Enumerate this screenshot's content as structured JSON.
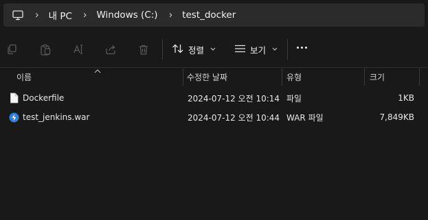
{
  "address_bar": {
    "breadcrumbs": [
      "내 PC",
      "Windows (C:)",
      "test_docker"
    ],
    "separator": "›"
  },
  "toolbar": {
    "sort_label": "정렬",
    "view_label": "보기"
  },
  "columns": {
    "name": "이름",
    "modified": "수정한 날짜",
    "type": "유형",
    "size": "크기"
  },
  "files": [
    {
      "name": "Dockerfile",
      "modified": "2024-07-12 오전 10:14",
      "type": "파일",
      "size": "1KB",
      "icon": "file-icon"
    },
    {
      "name": "test_jenkins.war",
      "modified": "2024-07-12 오전 10:44",
      "type": "WAR 파일",
      "size": "7,849KB",
      "icon": "war-file-icon"
    }
  ],
  "colors": {
    "background": "#191919",
    "address_bar": "#2b2b2b",
    "accent_blue": "#2f7fd6",
    "disabled_icon": "#5a5a5a"
  }
}
